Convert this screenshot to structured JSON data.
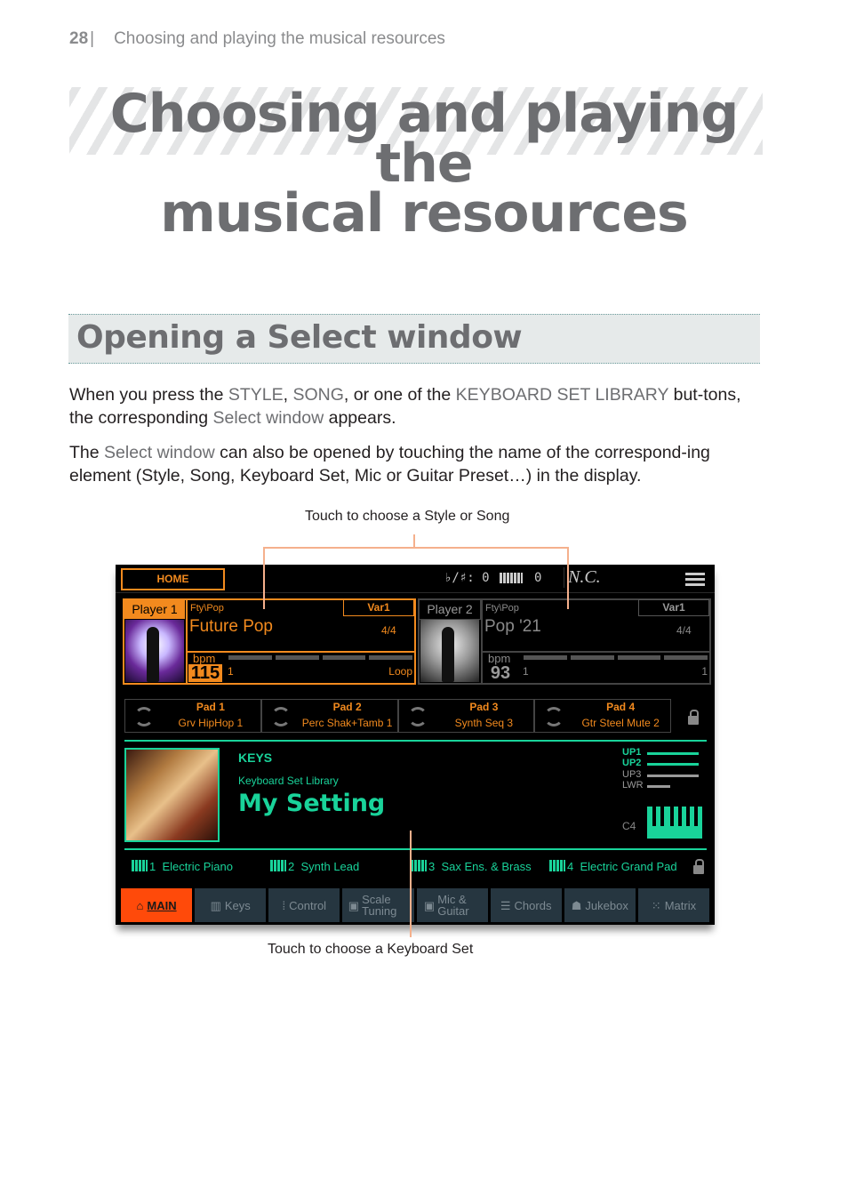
{
  "running_header": {
    "page_number": "28",
    "separator": "|",
    "section": "Choosing and playing the musical resources"
  },
  "chapter_title_line1": "Choosing and playing the",
  "chapter_title_line2": "musical resources",
  "section_title": "Opening a Select window",
  "paragraph1": {
    "t1": "When you press the ",
    "k1": "STYLE",
    "t2": ", ",
    "k2": "SONG",
    "t3": ", or one of the ",
    "k3": "KEYBOARD SET LIBRARY",
    "t4": " but-tons, the corresponding ",
    "k4": "Select window",
    "t5": " appears."
  },
  "paragraph2": {
    "t1": "The ",
    "k1": "Select window",
    "t2": " can also be opened by touching the name of the correspond-ing element (Style, Song, Keyboard Set, Mic or Guitar Preset…) in the display."
  },
  "callouts": {
    "top": "Touch to choose a Style or Song",
    "bottom": "Touch to choose a Keyboard Set"
  },
  "screen": {
    "home_label": "HOME",
    "key_sig_label": "♭/♯:",
    "key_sig_value": "0",
    "transpose_value": "0",
    "chord": "N.C.",
    "players": [
      {
        "label": "Player 1",
        "genre": "Fty\\Pop",
        "variation": "Var1",
        "style": "Future Pop",
        "meter": "4/4",
        "bpm_label": "bpm",
        "bpm": "115",
        "measure": "1",
        "status": "Loop"
      },
      {
        "label": "Player 2",
        "genre": "Fty\\Pop",
        "variation": "Var1",
        "style": "Pop '21",
        "meter": "4/4",
        "bpm_label": "bpm",
        "bpm": "93",
        "measure": "1",
        "status": "1"
      }
    ],
    "pads": [
      {
        "name": "Pad 1",
        "sound": "Grv HipHop 1"
      },
      {
        "name": "Pad 2",
        "sound": "Perc Shak+Tamb 1"
      },
      {
        "name": "Pad 3",
        "sound": "Synth Seq 3"
      },
      {
        "name": "Pad 4",
        "sound": "Gtr Steel Mute 2"
      }
    ],
    "keyboard": {
      "title": "KEYS",
      "library": "Keyboard Set Library",
      "name": "My Setting",
      "layers": [
        "UP1",
        "UP2",
        "UP3",
        "LWR"
      ],
      "split_note": "C4"
    },
    "sounds": [
      {
        "num": "1",
        "name": "Electric Piano"
      },
      {
        "num": "2",
        "name": "Synth Lead"
      },
      {
        "num": "3",
        "name": "Sax Ens. & Brass"
      },
      {
        "num": "4",
        "name": "Electric Grand Pad"
      }
    ],
    "tabs": [
      "MAIN",
      "Keys",
      "Control",
      "Scale Tuning",
      "Mic & Guitar",
      "Chords",
      "Jukebox",
      "Matrix"
    ],
    "active_tab": "MAIN",
    "colors": {
      "player_accent": "#f28a1e",
      "keyboard_accent": "#19d39a",
      "active_tab": "#ff4a0a",
      "callout_line": "#f5b08c"
    }
  }
}
